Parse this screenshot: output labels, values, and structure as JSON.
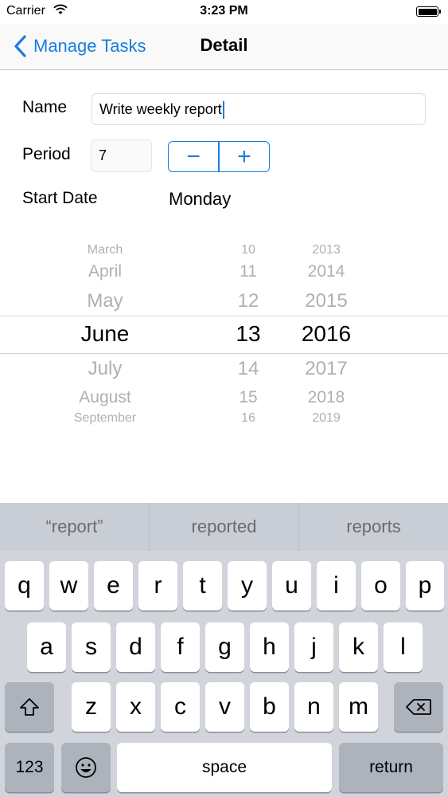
{
  "status_bar": {
    "carrier": "Carrier",
    "time": "3:23 PM"
  },
  "nav": {
    "back_label": "Manage Tasks",
    "title": "Detail"
  },
  "form": {
    "name_label": "Name",
    "name_value": "Write weekly report",
    "period_label": "Period",
    "period_value": "7",
    "minus_label": "−",
    "plus_label": "+",
    "start_date_label": "Start Date",
    "start_weekday": "Monday"
  },
  "date_picker": {
    "months": [
      "March",
      "April",
      "May",
      "June",
      "July",
      "August",
      "September"
    ],
    "days": [
      "10",
      "11",
      "12",
      "13",
      "14",
      "15",
      "16"
    ],
    "years": [
      "2013",
      "2014",
      "2015",
      "2016",
      "2017",
      "2018",
      "2019"
    ],
    "selected": {
      "month": "June",
      "day": "13",
      "year": "2016"
    }
  },
  "keyboard": {
    "suggestions": [
      "“report”",
      "reported",
      "reports"
    ],
    "row1": [
      "q",
      "w",
      "e",
      "r",
      "t",
      "y",
      "u",
      "i",
      "o",
      "p"
    ],
    "row2": [
      "a",
      "s",
      "d",
      "f",
      "g",
      "h",
      "j",
      "k",
      "l"
    ],
    "row3": [
      "z",
      "x",
      "c",
      "v",
      "b",
      "n",
      "m"
    ],
    "numbers_label": "123",
    "space_label": "space",
    "return_label": "return"
  },
  "colors": {
    "accent": "#1a7de0",
    "keyboard_bg": "#d1d5db"
  }
}
